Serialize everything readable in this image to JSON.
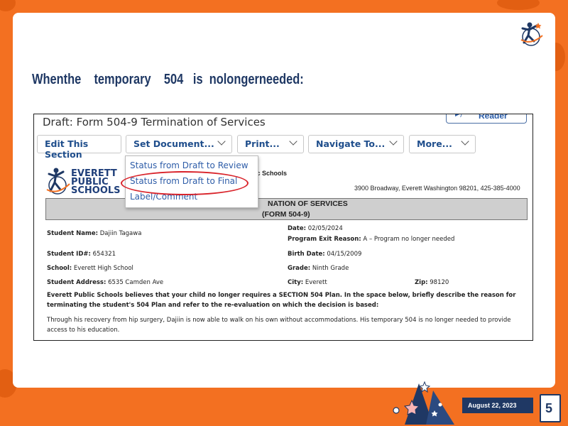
{
  "heading": "Whenthe    temporary    504   is  nolongerneeded:",
  "screenshot": {
    "doc_title": "Draft: Form 504-9 Termination of Services",
    "reader_label": "Reader",
    "toolbar": {
      "edit": "Edit This Section",
      "set_document": "Set Document...",
      "print": "Print...",
      "navigate": "Navigate To...",
      "more": "More..."
    },
    "menu_items": [
      "Status from Draft to Review",
      "Status from Draft to Final",
      "Label/Comment"
    ],
    "logo_lines": [
      "EVERETT",
      "PUBLIC",
      "SCHOOLS"
    ],
    "org_name": "t Public Schools",
    "address": "3900 Broadway, Everett Washington 98201, 425-385-4000",
    "section_title": "NATION OF SERVICES",
    "form_name": "(FORM 504-9)",
    "fields": {
      "student_name_label": "Student Name:",
      "student_name": "Dajiin Tagawa",
      "date_label": "Date:",
      "date": "02/05/2024",
      "exit_reason_label": "Program Exit Reason:",
      "exit_reason": "A – Program no longer needed",
      "student_id_label": "Student ID#:",
      "student_id": "654321",
      "birth_date_label": "Birth Date:",
      "birth_date": "04/15/2009",
      "school_label": "School:",
      "school": "Everett High School",
      "grade_label": "Grade:",
      "grade": "Ninth Grade",
      "address_label": "Student Address:",
      "address": "6535 Camden Ave",
      "city_label": "City:",
      "city": "Everett",
      "zip_label": "Zip:",
      "zip": "98120"
    },
    "statement": "Everett Public Schools believes that your child no longer requires a SECTION 504 Plan. In the space below, briefly describe the reason for terminating the student's 504 Plan and refer to the re-evaluation on which the decision is based:",
    "reason_text": "Through his recovery from hip surgery, Dajiin is now able to walk on his own without accommodations. His temporary 504 is no longer needed to provide access to his education."
  },
  "footer": {
    "date": "August  22, 2023",
    "page_number": "5"
  },
  "colors": {
    "background": "#f37021",
    "navy": "#1f3864",
    "highlight": "#d9232a"
  }
}
